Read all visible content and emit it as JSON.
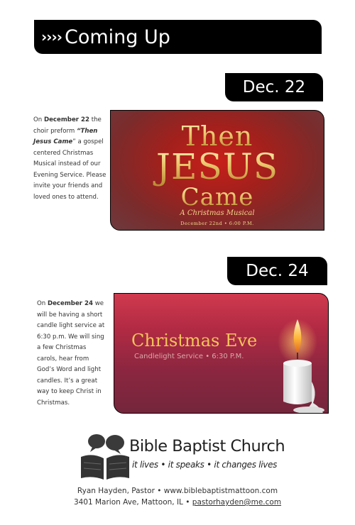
{
  "header": {
    "arrows": "››››",
    "title": "Coming Up"
  },
  "events": [
    {
      "date_tab": "Dec. 22",
      "blurb": {
        "p1": "On ",
        "b1": "December 22",
        "p2": " the choir preform ",
        "b2": "“Then Jesus Came",
        "p3": "” a gospel centered Christmas Musical instead of our Evening Service. Please invite your friends and loved ones to attend."
      },
      "image": {
        "line1": "Then",
        "line2": "JESUS",
        "line3": "Came",
        "subtitle": "A Christmas Musical",
        "date": "December 22nd • 6:00 P.M."
      }
    },
    {
      "date_tab": "Dec. 24",
      "blurb": {
        "p1": "On ",
        "b1": "December 24",
        "p2": " we will be having a short candle light service at 6:30 p.m.  We will sing a few Christmas carols, hear from God’s Word and light candles.  It’s a great way to keep Christ in Christmas."
      },
      "image": {
        "title": "Christmas Eve",
        "subtitle": "Candlelight Service • 6:30 P.M."
      }
    }
  ],
  "logo": {
    "name": "Bible Baptist Church",
    "tagline": "it lives • it speaks • it changes lives"
  },
  "footer": {
    "line1": "Ryan Hayden, Pastor • www.biblebaptistmattoon.com",
    "line2_prefix": "3401 Marion Ave, Mattoon, IL • ",
    "email": "pastorhayden@me.com"
  }
}
